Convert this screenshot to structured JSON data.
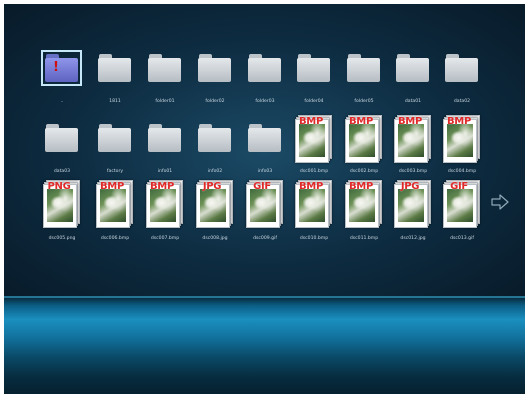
{
  "rows": [
    [
      {
        "type": "folder",
        "label": "..",
        "selected": true
      },
      {
        "type": "folder",
        "label": "1811"
      },
      {
        "type": "folder",
        "label": "folder01"
      },
      {
        "type": "folder",
        "label": "folder02"
      },
      {
        "type": "folder",
        "label": "folder03"
      },
      {
        "type": "folder",
        "label": "folder04"
      },
      {
        "type": "folder",
        "label": "folder05"
      },
      {
        "type": "folder",
        "label": "data01"
      },
      {
        "type": "folder",
        "label": "data02"
      }
    ],
    [
      {
        "type": "folder",
        "label": "data03"
      },
      {
        "type": "folder",
        "label": "factory"
      },
      {
        "type": "folder",
        "label": "info01"
      },
      {
        "type": "folder",
        "label": "info02"
      },
      {
        "type": "folder",
        "label": "info03"
      },
      {
        "type": "image",
        "format": "BMP",
        "label": "dsc001.bmp"
      },
      {
        "type": "image",
        "format": "BMP",
        "label": "dsc002.bmp"
      },
      {
        "type": "image",
        "format": "BMP",
        "label": "dsc003.bmp"
      },
      {
        "type": "image",
        "format": "BMP",
        "label": "dsc004.bmp"
      }
    ],
    [
      {
        "type": "image",
        "format": "PNG",
        "label": "dsc005.png"
      },
      {
        "type": "image",
        "format": "BMP",
        "label": "dsc006.bmp"
      },
      {
        "type": "image",
        "format": "BMP",
        "label": "dsc007.bmp"
      },
      {
        "type": "image",
        "format": "JPG",
        "label": "dsc008.jpg"
      },
      {
        "type": "image",
        "format": "GIF",
        "label": "dsc009.gif"
      },
      {
        "type": "image",
        "format": "BMP",
        "label": "dsc010.bmp"
      },
      {
        "type": "image",
        "format": "BMP",
        "label": "dsc011.bmp"
      },
      {
        "type": "image",
        "format": "JPG",
        "label": "dsc012.jpg"
      },
      {
        "type": "image",
        "format": "GIF",
        "label": "dsc013.gif"
      }
    ]
  ],
  "next_page_icon": "arrow-right-outline-icon",
  "colors": {
    "background_top": "#0d2b40",
    "floor_accent": "#1a8fbf",
    "selection_folder": "#6670c4",
    "format_text": "#e02a2a"
  }
}
